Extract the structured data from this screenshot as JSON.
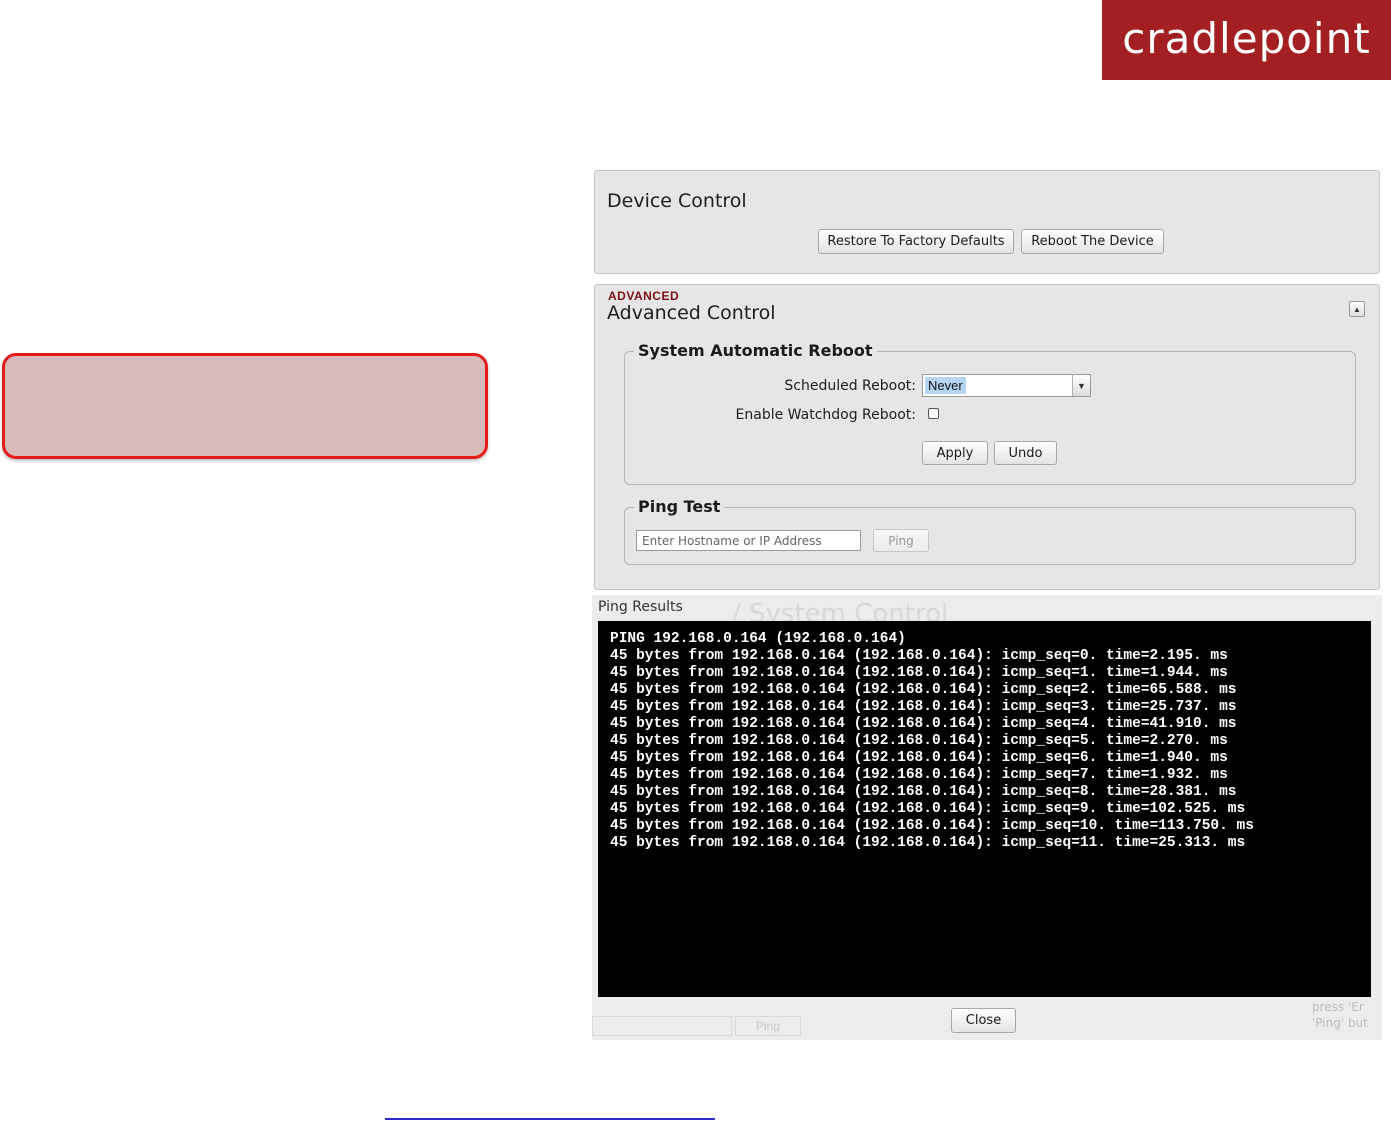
{
  "brand": {
    "logo_text": "cradlepoint",
    "logo_color": "#a31f22"
  },
  "device_control": {
    "title": "Device Control",
    "restore_button": "Restore To Factory Defaults",
    "reboot_button": "Reboot The Device"
  },
  "advanced_control": {
    "tag": "ADVANCED",
    "title": "Advanced Control",
    "collapse_icon": "collapse-up-icon",
    "system_reboot": {
      "legend": "System Automatic Reboot",
      "scheduled_label": "Scheduled Reboot:",
      "scheduled_value": "Never",
      "watchdog_label": "Enable Watchdog Reboot:",
      "watchdog_checked": false,
      "apply_button": "Apply",
      "undo_button": "Undo"
    },
    "ping_test": {
      "legend": "Ping Test",
      "placeholder": "Enter Hostname or IP Address",
      "ping_button": "Ping"
    }
  },
  "ping_results": {
    "title": "Ping Results",
    "background_title": "/ System Control",
    "background_ping": "Ping",
    "background_side": [
      "press 'Er",
      "'Ping' but"
    ],
    "lines": [
      "PING 192.168.0.164 (192.168.0.164)",
      "45 bytes from 192.168.0.164 (192.168.0.164): icmp_seq=0. time=2.195. ms",
      "45 bytes from 192.168.0.164 (192.168.0.164): icmp_seq=1. time=1.944. ms",
      "45 bytes from 192.168.0.164 (192.168.0.164): icmp_seq=2. time=65.588. ms",
      "45 bytes from 192.168.0.164 (192.168.0.164): icmp_seq=3. time=25.737. ms",
      "45 bytes from 192.168.0.164 (192.168.0.164): icmp_seq=4. time=41.910. ms",
      "45 bytes from 192.168.0.164 (192.168.0.164): icmp_seq=5. time=2.270. ms",
      "45 bytes from 192.168.0.164 (192.168.0.164): icmp_seq=6. time=1.940. ms",
      "45 bytes from 192.168.0.164 (192.168.0.164): icmp_seq=7. time=1.932. ms",
      "45 bytes from 192.168.0.164 (192.168.0.164): icmp_seq=8. time=28.381. ms",
      "45 bytes from 192.168.0.164 (192.168.0.164): icmp_seq=9. time=102.525. ms",
      "45 bytes from 192.168.0.164 (192.168.0.164): icmp_seq=10. time=113.750. ms",
      "45 bytes from 192.168.0.164 (192.168.0.164): icmp_seq=11. time=25.313. ms"
    ],
    "close_button": "Close"
  }
}
